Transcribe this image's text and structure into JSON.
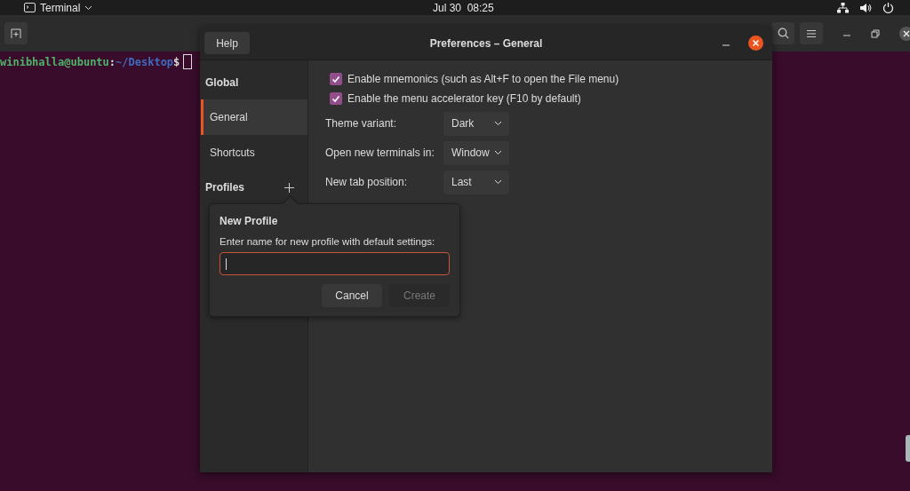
{
  "top_bar": {
    "app_menu": "Terminal",
    "clock": "Jul 30  08:25"
  },
  "terminal": {
    "user_host": "winibhalla@ubuntu",
    "separator": ":",
    "path": "~/Desktop",
    "symbol": "$"
  },
  "dialog": {
    "title": "Preferences – General",
    "help_button": "Help",
    "sidebar": [
      {
        "kind": "heading",
        "label": "Global"
      },
      {
        "kind": "item",
        "label": "General",
        "selected": true
      },
      {
        "kind": "item",
        "label": "Shortcuts",
        "selected": false
      },
      {
        "kind": "heading",
        "label": "Profiles",
        "add": true
      }
    ],
    "checkboxes": [
      {
        "label": "Enable mnemonics (such as Alt+F to open the File menu)",
        "checked": true
      },
      {
        "label": "Enable the menu accelerator key (F10 by default)",
        "checked": true
      }
    ],
    "settings": [
      {
        "label": "Theme variant:",
        "value": "Dark"
      },
      {
        "label": "Open new terminals in:",
        "value": "Window"
      },
      {
        "label": "New tab position:",
        "value": "Last"
      }
    ]
  },
  "popover": {
    "title": "New Profile",
    "prompt": "Enter name for new profile with default settings:",
    "buttons": [
      {
        "label": "Cancel",
        "disabled": false
      },
      {
        "label": "Create",
        "disabled": true
      }
    ]
  }
}
